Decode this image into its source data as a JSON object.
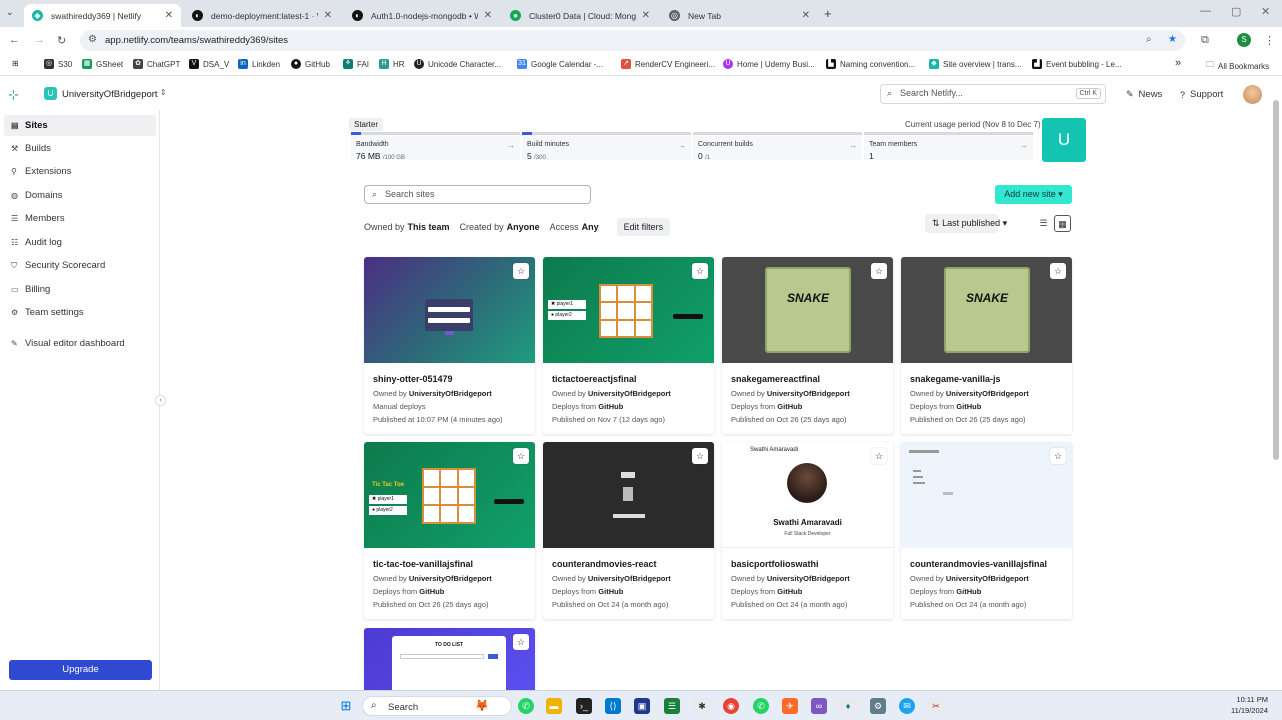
{
  "browser": {
    "tabs": [
      {
        "title": "swathireddy369 | Netlify",
        "active": true,
        "color": "#14b8a6"
      },
      {
        "title": "demo-deployment:latest-1 · W",
        "active": false,
        "color": "#111111"
      },
      {
        "title": "Auth1.0-nodejs-mongodb • W",
        "active": false,
        "color": "#111111"
      },
      {
        "title": "Cluster0 Data | Cloud: MongoD",
        "active": false,
        "color": "#13aa52"
      },
      {
        "title": "New Tab",
        "active": false,
        "color": "#5f6368"
      }
    ],
    "new_tab": "+",
    "url": "app.netlify.com/teams/swathireddy369/sites",
    "bookmarks": [
      "S30",
      "GSheet",
      "ChatGPT",
      "DSA_V",
      "Linkden",
      "GitHub",
      "FAI",
      "HR",
      "Unicode Character...",
      "Google Calendar -...",
      "RenderCV Engineeri...",
      "Home | Udemy Busi...",
      "Naming convention...",
      "Site overview | trans...",
      "Event bubbling - Le..."
    ],
    "bookmarks_more": "»",
    "all_bookmarks": "All Bookmarks"
  },
  "header": {
    "team_badge": "U",
    "team_name": "UniversityOfBridgeport",
    "search_placeholder": "Search Netlify...",
    "search_shortcut": "Ctrl K",
    "news": "News",
    "support": "Support"
  },
  "sidebar": {
    "items": [
      "Sites",
      "Builds",
      "Extensions",
      "Domains",
      "Members",
      "Audit log",
      "Security Scorecard",
      "Billing",
      "Team settings",
      "Visual editor dashboard"
    ],
    "active": "Sites",
    "upgrade": "Upgrade"
  },
  "plan": {
    "label": "Starter",
    "period": "Current usage period (Nov 8 to Dec 7)",
    "badge": "U",
    "usage": [
      {
        "label": "Bandwidth",
        "value": "76 MB",
        "limit": "/100 GB",
        "fill": 0.01
      },
      {
        "label": "Build minutes",
        "value": "5",
        "limit": "/300",
        "fill": 0.02
      },
      {
        "label": "Concurrent builds",
        "value": "0",
        "limit": "/1",
        "fill": 0
      },
      {
        "label": "Team members",
        "value": "1",
        "limit": "",
        "fill": 0
      }
    ]
  },
  "toolbar": {
    "search_placeholder": "Search sites",
    "add_new_site": "Add new site",
    "owned_by_label": "Owned by",
    "owned_by_value": "This team",
    "created_by_label": "Created by",
    "created_by_value": "Anyone",
    "access_label": "Access",
    "access_value": "Any",
    "edit_filters": "Edit filters",
    "sort": "Last published"
  },
  "sites": [
    {
      "name": "shiny-otter-051479",
      "owner_label": "Owned by",
      "owner": "UniversityOfBridgeport",
      "deploy_prefix": "",
      "deploy": "Manual deploys",
      "published": "Published at 10:07 PM (4 minutes ago)"
    },
    {
      "name": "tictactoereactjsfinal",
      "owner_label": "Owned by",
      "owner": "UniversityOfBridgeport",
      "deploy_prefix": "Deploys from",
      "deploy": "GitHub",
      "published": "Published on Nov 7 (12 days ago)"
    },
    {
      "name": "snakegamereactfinal",
      "owner_label": "Owned by",
      "owner": "UniversityOfBridgeport",
      "deploy_prefix": "Deploys from",
      "deploy": "GitHub",
      "published": "Published on Oct 26 (25 days ago)"
    },
    {
      "name": "snakegame-vanilla-js",
      "owner_label": "Owned by",
      "owner": "UniversityOfBridgeport",
      "deploy_prefix": "Deploys from",
      "deploy": "GitHub",
      "published": "Published on Oct 26 (25 days ago)"
    },
    {
      "name": "tic-tac-toe-vanillajsfinal",
      "owner_label": "Owned by",
      "owner": "UniversityOfBridgeport",
      "deploy_prefix": "Deploys from",
      "deploy": "GitHub",
      "published": "Published on Oct 26 (25 days ago)"
    },
    {
      "name": "counterandmovies-react",
      "owner_label": "Owned by",
      "owner": "UniversityOfBridgeport",
      "deploy_prefix": "Deploys from",
      "deploy": "GitHub",
      "published": "Published on Oct 24 (a month ago)"
    },
    {
      "name": "basicportfolioswathi",
      "owner_label": "Owned by",
      "owner": "UniversityOfBridgeport",
      "deploy_prefix": "Deploys from",
      "deploy": "GitHub",
      "published": "Published on Oct 24 (a month ago)"
    },
    {
      "name": "counterandmovies-vanillajsfinal",
      "owner_label": "Owned by",
      "owner": "UniversityOfBridgeport",
      "deploy_prefix": "Deploys from",
      "deploy": "GitHub",
      "published": "Published on Oct 24 (a month ago)"
    }
  ],
  "thumb_text": {
    "ttt_title": "Tic Tac Toe",
    "player1": "player1",
    "player2": "player2",
    "snake": "SNAKE",
    "portfolio_name": "Swathi Amaravadi",
    "portfolio_role": "Full Stack Developer",
    "portfolio_header": "Swathi Amaravadi",
    "todo": "TO DO LIST"
  },
  "taskbar": {
    "search": "Search",
    "time": "10:11 PM",
    "date": "11/19/2024"
  }
}
